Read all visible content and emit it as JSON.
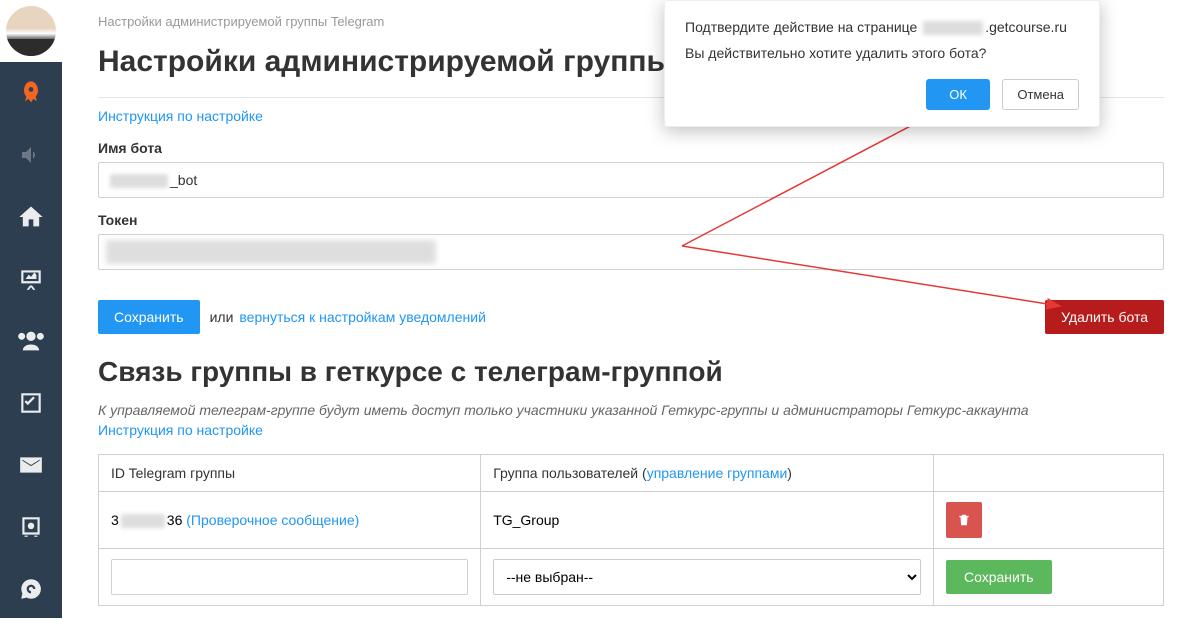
{
  "breadcrumb": "Настройки администрируемой группы Telegram",
  "heading1": "Настройки администрируемой группы Telegram",
  "instruction_link": "Инструкция по настройке",
  "bot_name_label": "Имя бота",
  "bot_name_suffix": "_bot",
  "token_label": "Токен",
  "save_btn": "Сохранить",
  "or_text": "или",
  "return_link": "вернуться к настройкам уведомлений",
  "delete_bot_btn": "Удалить бота",
  "heading2": "Связь группы в геткурсе с телеграм-группой",
  "note": "К управляемой телеграм-группе будут иметь доступ только участники указанной Геткурс-группы и администраторы Геткурс-аккаунта",
  "instruction_link2": "Инструкция по настройке",
  "table": {
    "col1": "ID Telegram группы",
    "col2_pre": "Группа пользователей (",
    "col2_link": "управление группами",
    "col2_post": ")",
    "row1_prefix": "3",
    "row1_suffix": "36",
    "row1_link": "(Проверочное сообщение)",
    "row1_group": "TG_Group",
    "select_default": "--не выбран--",
    "save2": "Сохранить"
  },
  "dialog": {
    "line1_pre": "Подтвердите действие на странице ",
    "line1_post": ".getcourse.ru",
    "line2": "Вы действительно хотите удалить этого бота?",
    "ok": "ОК",
    "cancel": "Отмена"
  }
}
